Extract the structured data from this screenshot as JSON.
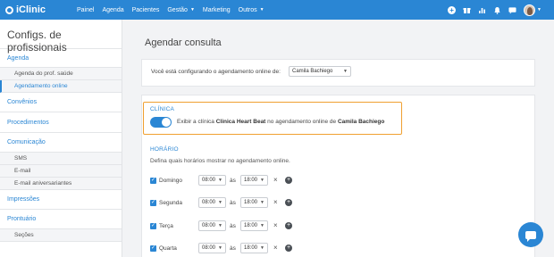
{
  "app": {
    "name": "iClinic"
  },
  "nav": {
    "items": [
      {
        "label": "Painel",
        "dropdown": false
      },
      {
        "label": "Agenda",
        "dropdown": false
      },
      {
        "label": "Pacientes",
        "dropdown": false
      },
      {
        "label": "Gestão",
        "dropdown": true
      },
      {
        "label": "Marketing",
        "dropdown": false
      },
      {
        "label": "Outros",
        "dropdown": true
      }
    ],
    "icons": [
      "add-circle-icon",
      "gift-icon",
      "chart-icon",
      "bell-icon",
      "chat-icon",
      "avatar"
    ]
  },
  "sidebar": {
    "title": "Configs. de profissionais",
    "sections": [
      {
        "label": "Agenda",
        "subitems": [
          {
            "label": "Agenda do prof. saúde",
            "active": false
          },
          {
            "label": "Agendamento online",
            "active": true
          }
        ]
      },
      {
        "label": "Convênios",
        "subitems": []
      },
      {
        "label": "Procedimentos",
        "subitems": []
      },
      {
        "label": "Comunicação",
        "subitems": [
          {
            "label": "SMS",
            "active": false
          },
          {
            "label": "E-mail",
            "active": false
          },
          {
            "label": "E-mail aniversariantes",
            "active": false
          }
        ]
      },
      {
        "label": "Impressões",
        "subitems": []
      },
      {
        "label": "Prontuário",
        "subitems": [
          {
            "label": "Seções",
            "active": false
          }
        ]
      }
    ]
  },
  "main": {
    "title": "Agendar consulta",
    "config_label": "Você está configurando o agendamento online de:",
    "professional_select": "Camila Bachiego",
    "clinic_section": {
      "label": "CLÍNICA",
      "toggle_on": true,
      "text_prefix": "Exibir a clínica",
      "clinic_name": "Clinica Heart Beat",
      "text_middle": "no agendamento online de",
      "professional_name": "Camila Bachiego"
    },
    "schedule_section": {
      "label": "HORÁRIO",
      "hint": "Defina quais horários mostrar no agendamento online.",
      "separator": "às",
      "days": [
        {
          "name": "Domingo",
          "checked": true,
          "start": "08:00",
          "end": "18:00"
        },
        {
          "name": "Segunda",
          "checked": true,
          "start": "08:00",
          "end": "18:00"
        },
        {
          "name": "Terça",
          "checked": true,
          "start": "08:00",
          "end": "18:00"
        },
        {
          "name": "Quarta",
          "checked": true,
          "start": "08:00",
          "end": "18:00"
        }
      ]
    }
  },
  "colors": {
    "primary": "#2a86d4",
    "highlight": "#f0a030"
  }
}
